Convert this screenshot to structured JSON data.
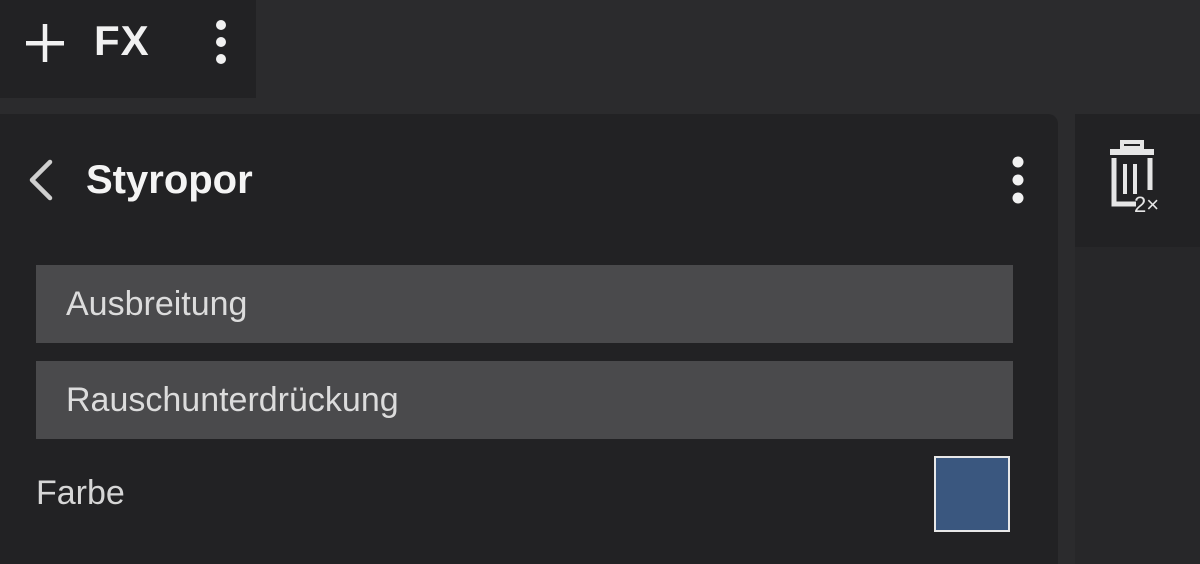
{
  "toolbar": {
    "title": "FX",
    "add_icon": "plus-icon",
    "menu_icon": "more-vertical-icon"
  },
  "panel": {
    "title": "Styropor",
    "back_icon": "chevron-left-icon",
    "menu_icon": "more-vertical-icon",
    "items": [
      {
        "label": "Ausbreitung"
      },
      {
        "label": "Rauschunterdrückung"
      }
    ],
    "color": {
      "label": "Farbe",
      "value": "#3a577f"
    }
  },
  "side": {
    "trash_icon": "trash-icon",
    "count": "2×"
  },
  "colors": {
    "background": "#2b2b2d",
    "panel": "#222224",
    "row": "#4a4a4c"
  }
}
